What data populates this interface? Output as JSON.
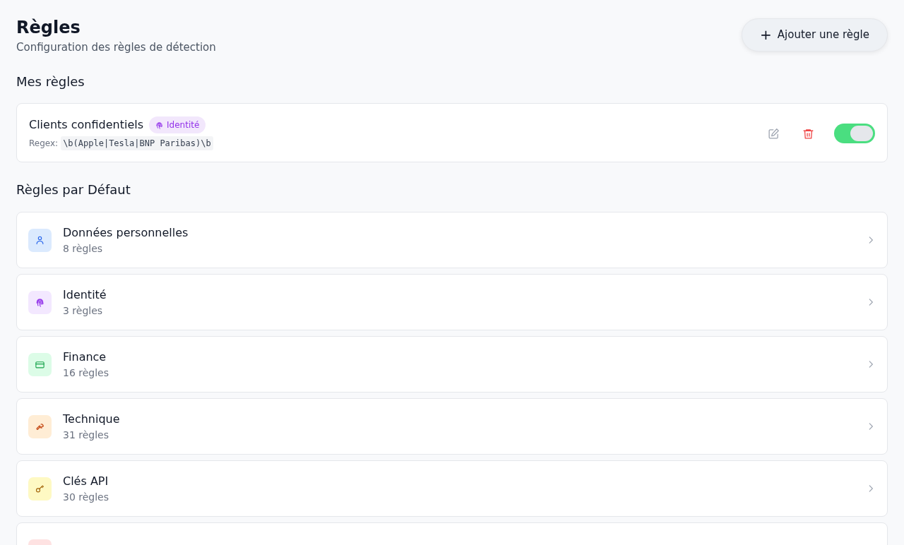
{
  "header": {
    "title": "Règles",
    "subtitle": "Configuration des règles de détection",
    "add_button": {
      "icon": "+",
      "label": "Ajouter une règle"
    }
  },
  "my_rules": {
    "heading": "Mes règles",
    "rules": [
      {
        "name": "Clients confidentiels",
        "tag": {
          "label": "Identité",
          "kind": "fingerprint",
          "color": "#9333ea"
        },
        "pattern_label": "Regex:",
        "pattern": "\\b(Apple|Tesla|BNP Paribas)\\b",
        "enabled": true
      }
    ]
  },
  "default_rules": {
    "heading": "Règles par Défaut",
    "categories": [
      {
        "kind": "person",
        "color": "#dbeafe",
        "name": "Données personnelles",
        "count": "8 règles"
      },
      {
        "kind": "fingerprint",
        "color": "#f3e8ff",
        "name": "Identité",
        "count": "3 règles"
      },
      {
        "kind": "card",
        "color": "#dcfce7",
        "name": "Finance",
        "count": "16 règles"
      },
      {
        "kind": "wrench",
        "color": "#ffedd5",
        "name": "Technique",
        "count": "31 règles"
      },
      {
        "kind": "key",
        "color": "#fef9c3",
        "name": "Clés API",
        "count": "30 règles"
      },
      {
        "kind": "none",
        "color": "#fee2e2"
      }
    ]
  }
}
